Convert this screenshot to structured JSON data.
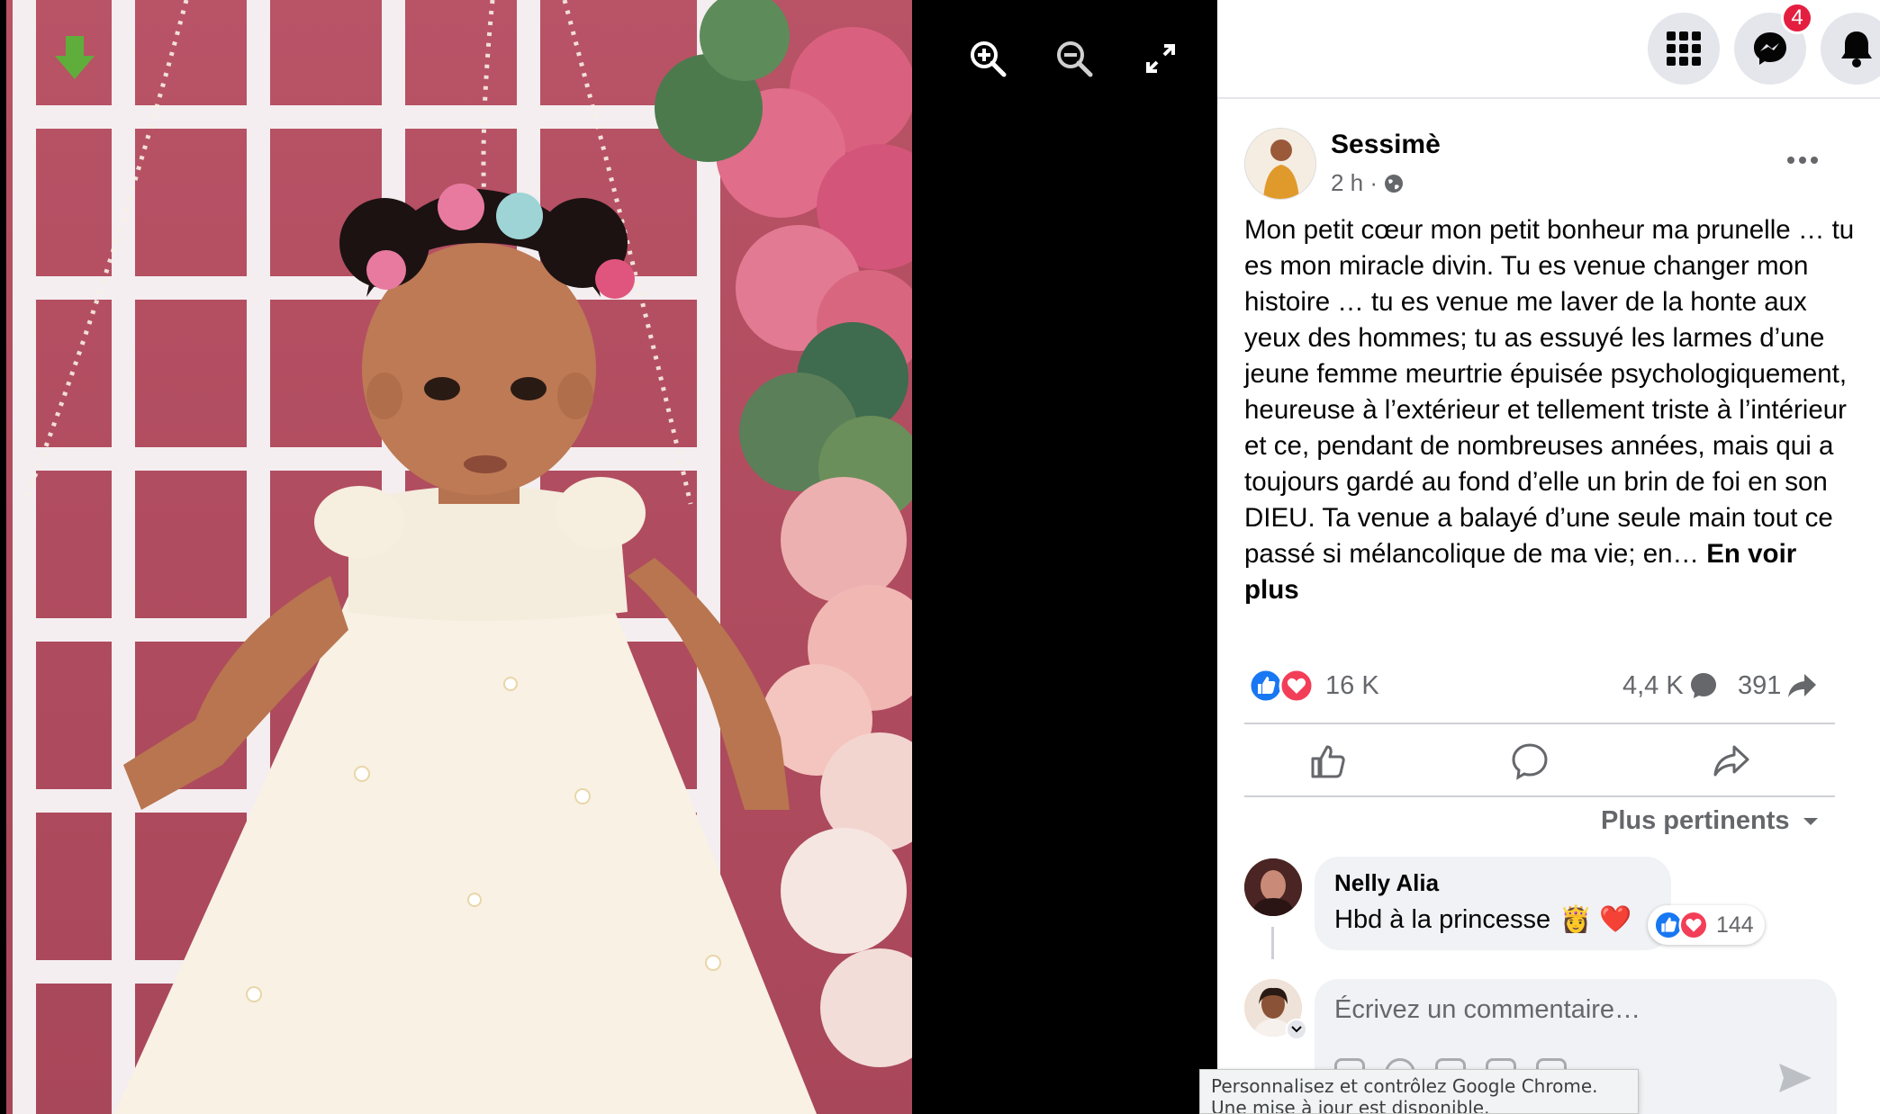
{
  "viewer": {
    "icons": [
      "download-arrow-icon",
      "zoom-in-icon",
      "zoom-out-icon",
      "fullscreen-icon"
    ]
  },
  "topbar": {
    "icons": [
      "apps-grid-icon",
      "messenger-icon",
      "bell-icon"
    ],
    "messenger_badge": "4"
  },
  "post": {
    "author": "Sessimè",
    "time": "2 h ·",
    "audience_icon": "globe-icon",
    "text": "Mon petit cœur mon petit bonheur ma prunelle … tu es mon miracle divin. Tu es venue changer mon histoire … tu es venue me laver de la honte aux yeux des hommes; tu as essuyé les larmes d’une jeune femme meurtrie épuisée psychologiquement, heureuse à l’extérieur et tellement triste à l’intérieur et ce, pendant de nombreuses années, mais qui a toujours gardé au fond d’elle un brin de foi en son DIEU. Ta venue a balayé d’une seule main tout ce passé si mélancolique de ma vie; en…",
    "see_more": "En voir plus",
    "reactions_count": "16 K",
    "comments_count": "4,4 K",
    "shares_count": "391",
    "colors": {
      "like": "#1877f2",
      "love": "#f33e58",
      "accent_badge": "#e41e3f"
    }
  },
  "comments": {
    "sort_label": "Plus pertinents",
    "items": [
      {
        "author": "Nelly Alia",
        "text": "Hbd à la princesse",
        "emoji": "👸 ❤️",
        "reactions": "144"
      }
    ],
    "composer_placeholder": "Écrivez un commentaire…"
  },
  "chrome_tooltip": {
    "line1": "Personnalisez et contrôlez Google Chrome.",
    "line2": "Une mise à jour est disponible."
  }
}
